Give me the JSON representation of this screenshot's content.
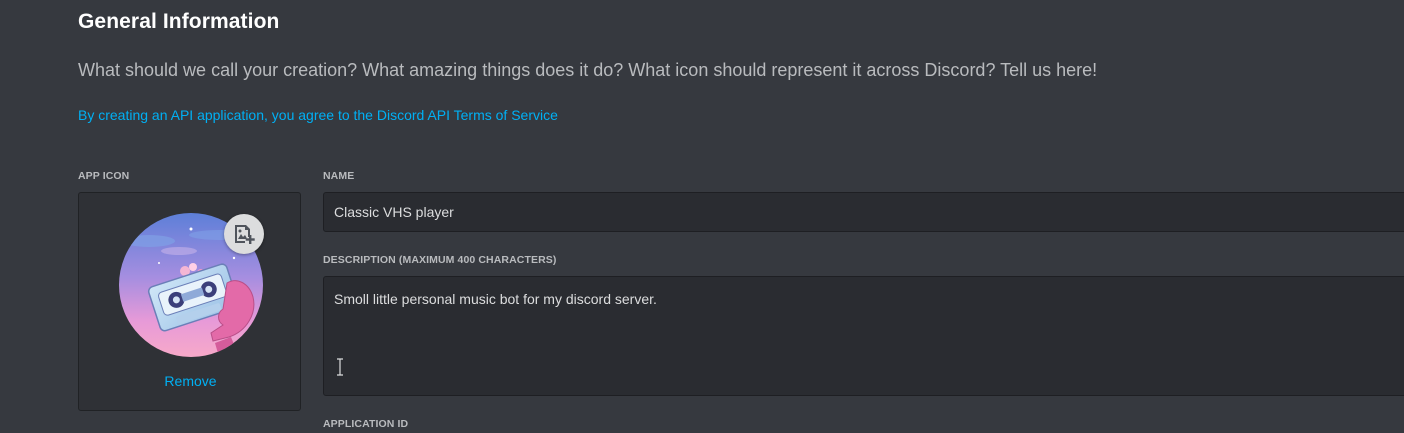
{
  "section": {
    "title": "General Information",
    "subtitle": "What should we call your creation? What amazing things does it do? What icon should represent it across Discord? Tell us here!",
    "tos_link": "By creating an API application, you agree to the Discord API Terms of Service"
  },
  "app_icon": {
    "label": "APP ICON",
    "remove_label": "Remove",
    "upload_icon": "image-add-icon",
    "avatar_image": "vhs-cassette-artwork"
  },
  "fields": {
    "name_label": "NAME",
    "name_value": "Classic VHS player",
    "description_label": "DESCRIPTION (MAXIMUM 400 CHARACTERS)",
    "description_value": "Smoll little personal music bot for my discord server.",
    "application_id_label": "APPLICATION ID"
  },
  "colors": {
    "background": "#36393f",
    "link": "#00b0f4",
    "input_bg": "#2a2c31"
  }
}
